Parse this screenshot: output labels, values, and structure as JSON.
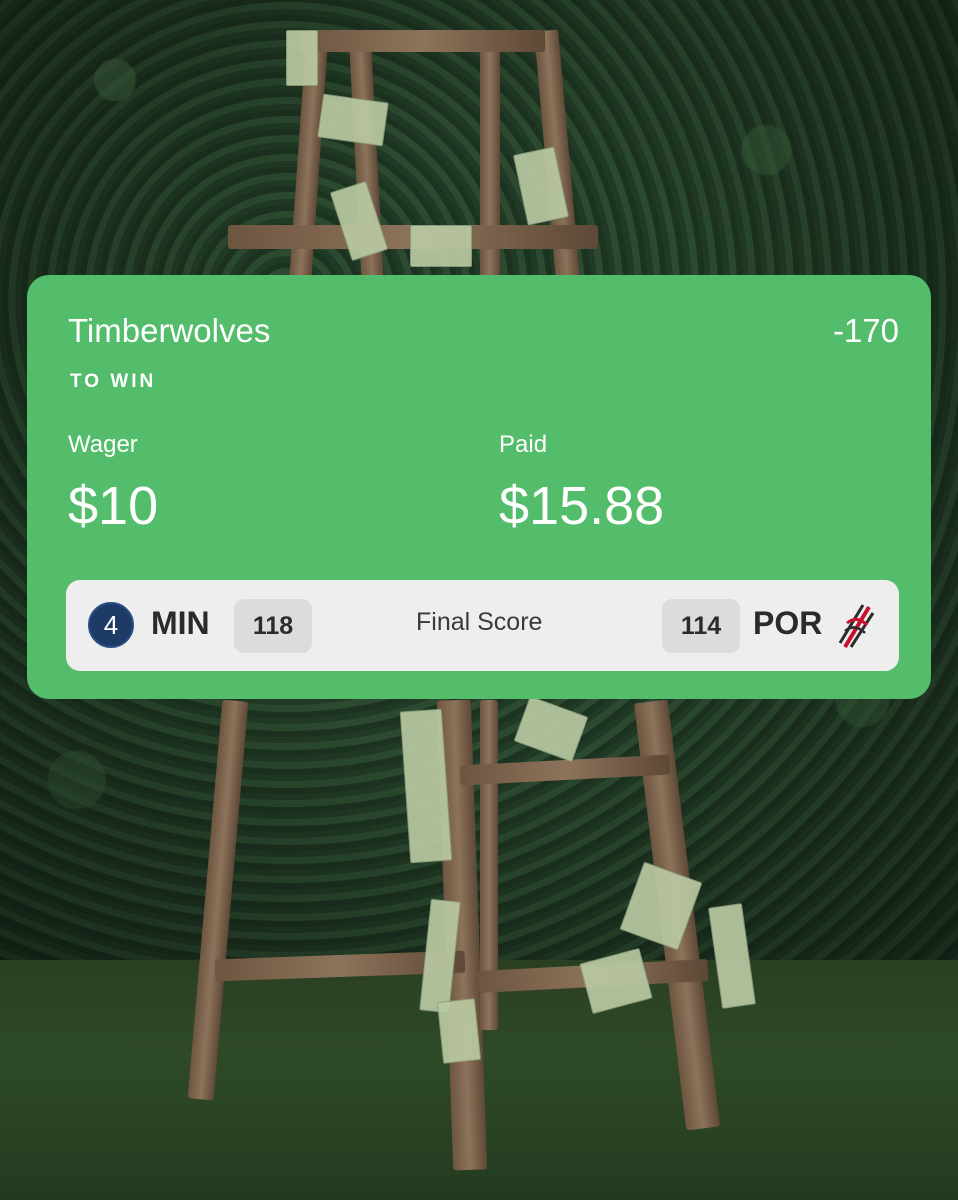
{
  "bet": {
    "team": "Timberwolves",
    "odds": "-170",
    "market": "TO WIN",
    "wager_label": "Wager",
    "wager_amount": "$10",
    "paid_label": "Paid",
    "paid_amount": "$15.88"
  },
  "score": {
    "home_icon": "timberwolves-logo-icon",
    "home_abbr": "MIN",
    "home_score": "118",
    "status": "Final Score",
    "away_score": "114",
    "away_abbr": "POR",
    "away_icon": "trail-blazers-logo-icon"
  },
  "colors": {
    "card_green": "#54bd6b",
    "scorebar_bg": "#eeeeee",
    "min_navy": "#1e3a66",
    "por_red": "#c8102e"
  }
}
